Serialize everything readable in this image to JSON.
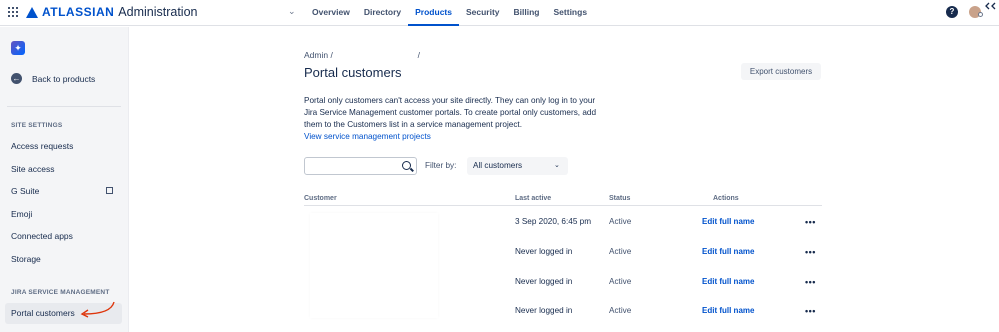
{
  "header": {
    "brand": "ATLASSIAN",
    "product": "Administration",
    "nav": [
      "Overview",
      "Directory",
      "Products",
      "Security",
      "Billing",
      "Settings"
    ],
    "active_nav": "Products",
    "help_label": "?"
  },
  "sidebar": {
    "back_label": "Back to products",
    "section_site": "SITE SETTINGS",
    "items": [
      "Access requests",
      "Site access",
      "G Suite",
      "Emoji",
      "Connected apps",
      "Storage"
    ],
    "section_jsm": "JIRA SERVICE MANAGEMENT",
    "active_item": "Portal customers"
  },
  "main": {
    "breadcrumb_root": "Admin",
    "breadcrumb_sep": "/",
    "title": "Portal customers",
    "export_label": "Export customers",
    "description": "Portal only customers can't access your site directly. They can only log in to your Jira Service Management customer portals. To create portal only customers, add them to the Customers list in a service management project.",
    "description_link": "View service management projects",
    "filter_label": "Filter by:",
    "filter_value": "All customers",
    "columns": [
      "Customer",
      "Last active",
      "Status",
      "Actions"
    ],
    "rows": [
      {
        "last_active": "3 Sep 2020, 6:45 pm",
        "status": "Active",
        "action": "Edit full name",
        "more": "•••"
      },
      {
        "last_active": "Never logged in",
        "status": "Active",
        "action": "Edit full name",
        "more": "•••"
      },
      {
        "last_active": "Never logged in",
        "status": "Active",
        "action": "Edit full name",
        "more": "•••"
      },
      {
        "last_active": "Never logged in",
        "status": "Active",
        "action": "Edit full name",
        "more": "•••"
      }
    ]
  },
  "colors": {
    "accent": "#0052cc",
    "sidebar_bg": "#f4f5f7",
    "annotation_arrow": "#de350b"
  }
}
